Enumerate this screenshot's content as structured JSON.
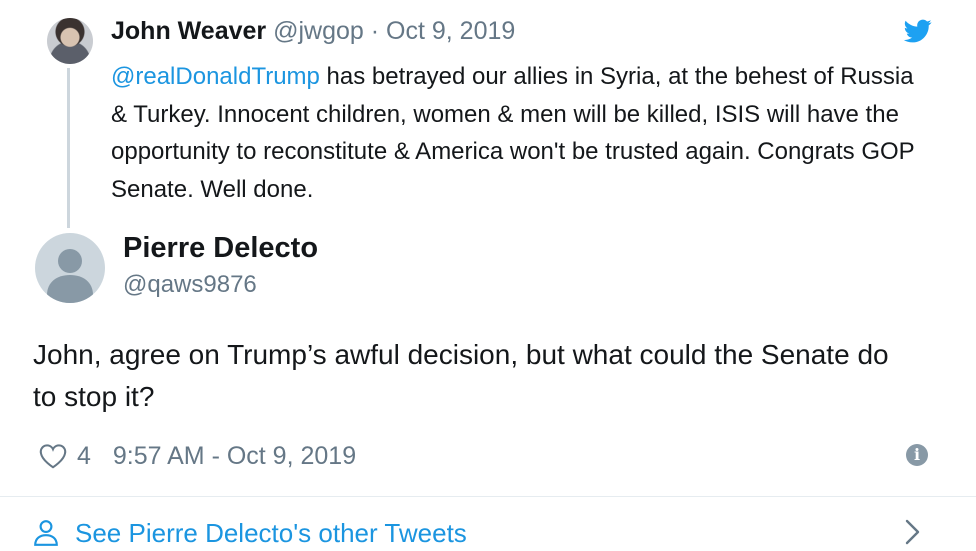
{
  "parent_tweet": {
    "author_name": "John Weaver",
    "author_handle": "@jwgop",
    "separator": "·",
    "date": "Oct 9, 2019",
    "mention": "@realDonaldTrump",
    "text": " has betrayed our allies in Syria, at the behest of Russia & Turkey. Innocent children, women & men will be killed, ISIS will have the opportunity to reconstitute & America won't be trusted again. Congrats GOP Senate. Well done."
  },
  "reply_tweet": {
    "author_name": "Pierre Delecto",
    "author_handle": "@qaws9876",
    "text": "John, agree on Trump’s awful decision, but what could the Senate do to stop it?",
    "like_count": "4",
    "timestamp": "9:57 AM - Oct 9, 2019"
  },
  "footer": {
    "link_text": "See Pierre Delecto's other Tweets"
  },
  "icons": {
    "brand": "twitter-bird-icon",
    "like": "heart-icon",
    "info": "info-icon",
    "profile": "person-icon",
    "more": "chevron-right-icon"
  },
  "colors": {
    "accent": "#1da1f2",
    "link": "#1b95e0",
    "muted": "#657786",
    "text": "#14171a",
    "divider": "#e6ecf0"
  }
}
